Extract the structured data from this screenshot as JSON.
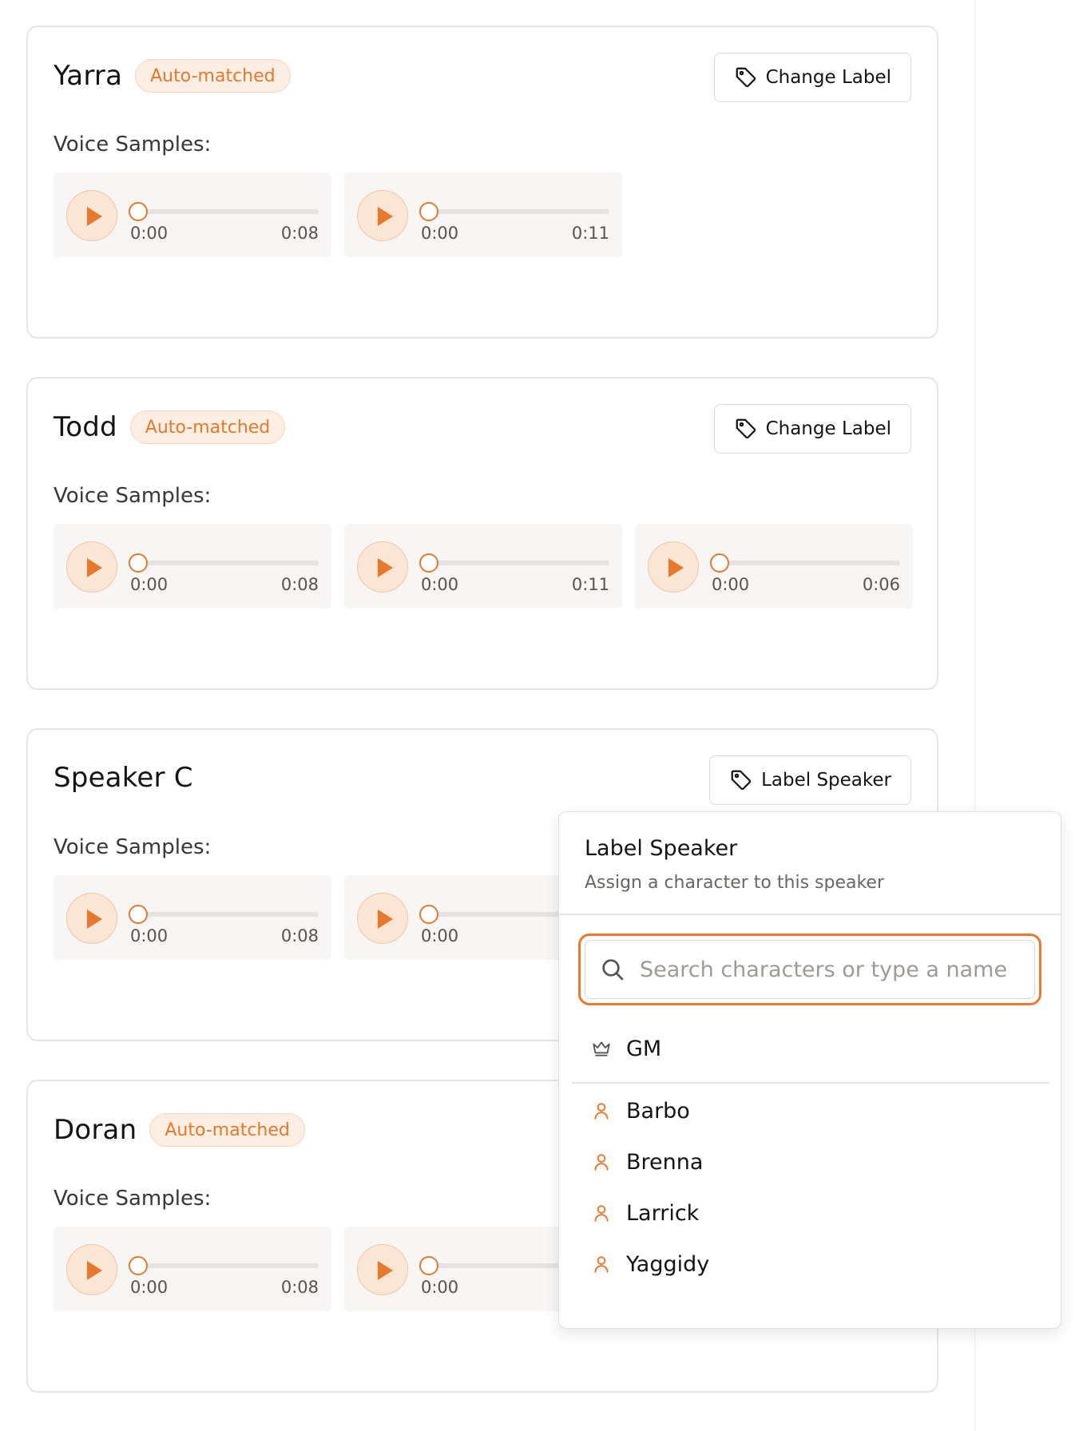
{
  "colors": {
    "accent": "#e8782b",
    "badge_bg": "#fdeee4",
    "card_border": "#e8e6e4"
  },
  "voice_samples_label": "Voice Samples:",
  "speakers": [
    {
      "name": "Yarra",
      "badge": "Auto-matched",
      "action": "Change Label",
      "action_icon": "tag-icon",
      "samples": [
        {
          "current": "0:00",
          "duration": "0:08"
        },
        {
          "current": "0:00",
          "duration": "0:11"
        }
      ]
    },
    {
      "name": "Todd",
      "badge": "Auto-matched",
      "action": "Change Label",
      "action_icon": "tag-icon",
      "samples": [
        {
          "current": "0:00",
          "duration": "0:08"
        },
        {
          "current": "0:00",
          "duration": "0:11"
        },
        {
          "current": "0:00",
          "duration": "0:06"
        }
      ]
    },
    {
      "name": "Speaker C",
      "badge": "",
      "action": "Label Speaker",
      "action_icon": "tag-icon",
      "samples": [
        {
          "current": "0:00",
          "duration": "0:08"
        },
        {
          "current": "0:00",
          "duration": ""
        }
      ]
    },
    {
      "name": "Doran",
      "badge": "Auto-matched",
      "action": "",
      "action_icon": "",
      "samples": [
        {
          "current": "0:00",
          "duration": "0:08"
        },
        {
          "current": "0:00",
          "duration": ""
        }
      ]
    }
  ],
  "popover": {
    "title": "Label Speaker",
    "subtitle": "Assign a character to this speaker",
    "search_placeholder": "Search characters or type a name",
    "gm_option": {
      "label": "GM",
      "icon": "crown-icon"
    },
    "characters": [
      {
        "label": "Barbo",
        "icon": "user-icon"
      },
      {
        "label": "Brenna",
        "icon": "user-icon"
      },
      {
        "label": "Larrick",
        "icon": "user-icon"
      },
      {
        "label": "Yaggidy",
        "icon": "user-icon"
      }
    ]
  }
}
